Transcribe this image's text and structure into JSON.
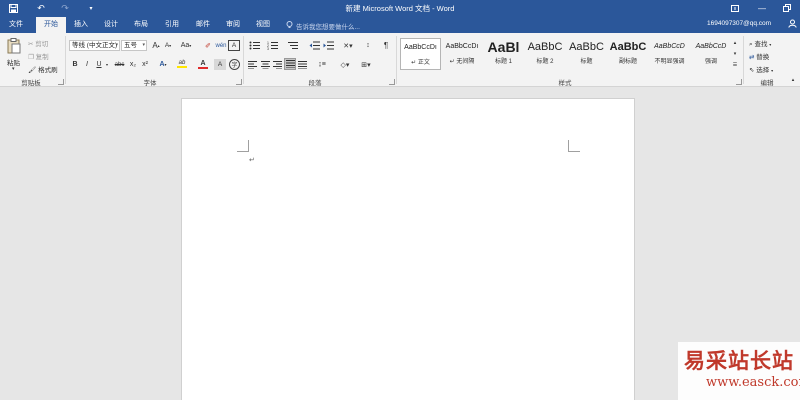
{
  "window": {
    "title": "新建 Microsoft Word 文档 - Word",
    "quick_access": [
      "save-icon",
      "undo-icon",
      "redo-icon",
      "customize-icon"
    ],
    "buttons": [
      "ribbon-display-icon",
      "minimize-icon",
      "restore-icon",
      "close-icon"
    ]
  },
  "tabs": [
    "文件",
    "开始",
    "插入",
    "设计",
    "布局",
    "引用",
    "邮件",
    "审阅",
    "视图"
  ],
  "active_tab": "开始",
  "tell_me": "告诉我您想要做什么...",
  "user": "1694097307@qq.com",
  "clipboard": {
    "paste": "粘贴",
    "cut": "剪切",
    "copy": "复制",
    "format_painter": "格式刷",
    "label": "剪贴板"
  },
  "font": {
    "font_name": "等线 (中文正文)",
    "font_size": "五号",
    "label": "字体",
    "change_case": "Aa",
    "bold": "B",
    "italic": "I",
    "underline": "U",
    "strikethrough": "abc",
    "subscript": "x₂",
    "superscript": "x²",
    "text_effects": "A",
    "highlight": "ab",
    "font_color": "A",
    "grow": "A",
    "shrink": "A",
    "char_border": "A"
  },
  "paragraph": {
    "label": "段落"
  },
  "styles": {
    "label": "样式",
    "items": [
      {
        "sample": "AaBbCcDı",
        "name": "↵ 正文",
        "size": "7px",
        "weight": "normal",
        "italic": false
      },
      {
        "sample": "AaBbCcDı",
        "name": "↵ 无间隔",
        "size": "7px",
        "weight": "normal",
        "italic": false
      },
      {
        "sample": "AaBl",
        "name": "标题 1",
        "size": "14px",
        "weight": "bold",
        "italic": false
      },
      {
        "sample": "AaBbC",
        "name": "标题 2",
        "size": "11px",
        "weight": "normal",
        "italic": false
      },
      {
        "sample": "AaBbC",
        "name": "标题",
        "size": "11px",
        "weight": "normal",
        "italic": false
      },
      {
        "sample": "AaBbC",
        "name": "副标题",
        "size": "11px",
        "weight": "bold",
        "italic": false
      },
      {
        "sample": "AaBbCcD",
        "name": "不明显强调",
        "size": "7px",
        "weight": "normal",
        "italic": true
      },
      {
        "sample": "AaBbCcD",
        "name": "强调",
        "size": "7px",
        "weight": "normal",
        "italic": true
      }
    ]
  },
  "editing": {
    "label": "编辑",
    "find": "查找",
    "replace": "替换",
    "select": "选择"
  },
  "document": {
    "paragraph_mark": "↵"
  },
  "watermark": {
    "text": "易采站长站",
    "url": "www.easck.com"
  },
  "colors": {
    "brand": "#2b579a",
    "ribbon": "#f3f3f3",
    "canvas": "#e6e6e6",
    "font_color_bar": "#e02b2b",
    "highlight_bar": "#ffe600"
  }
}
